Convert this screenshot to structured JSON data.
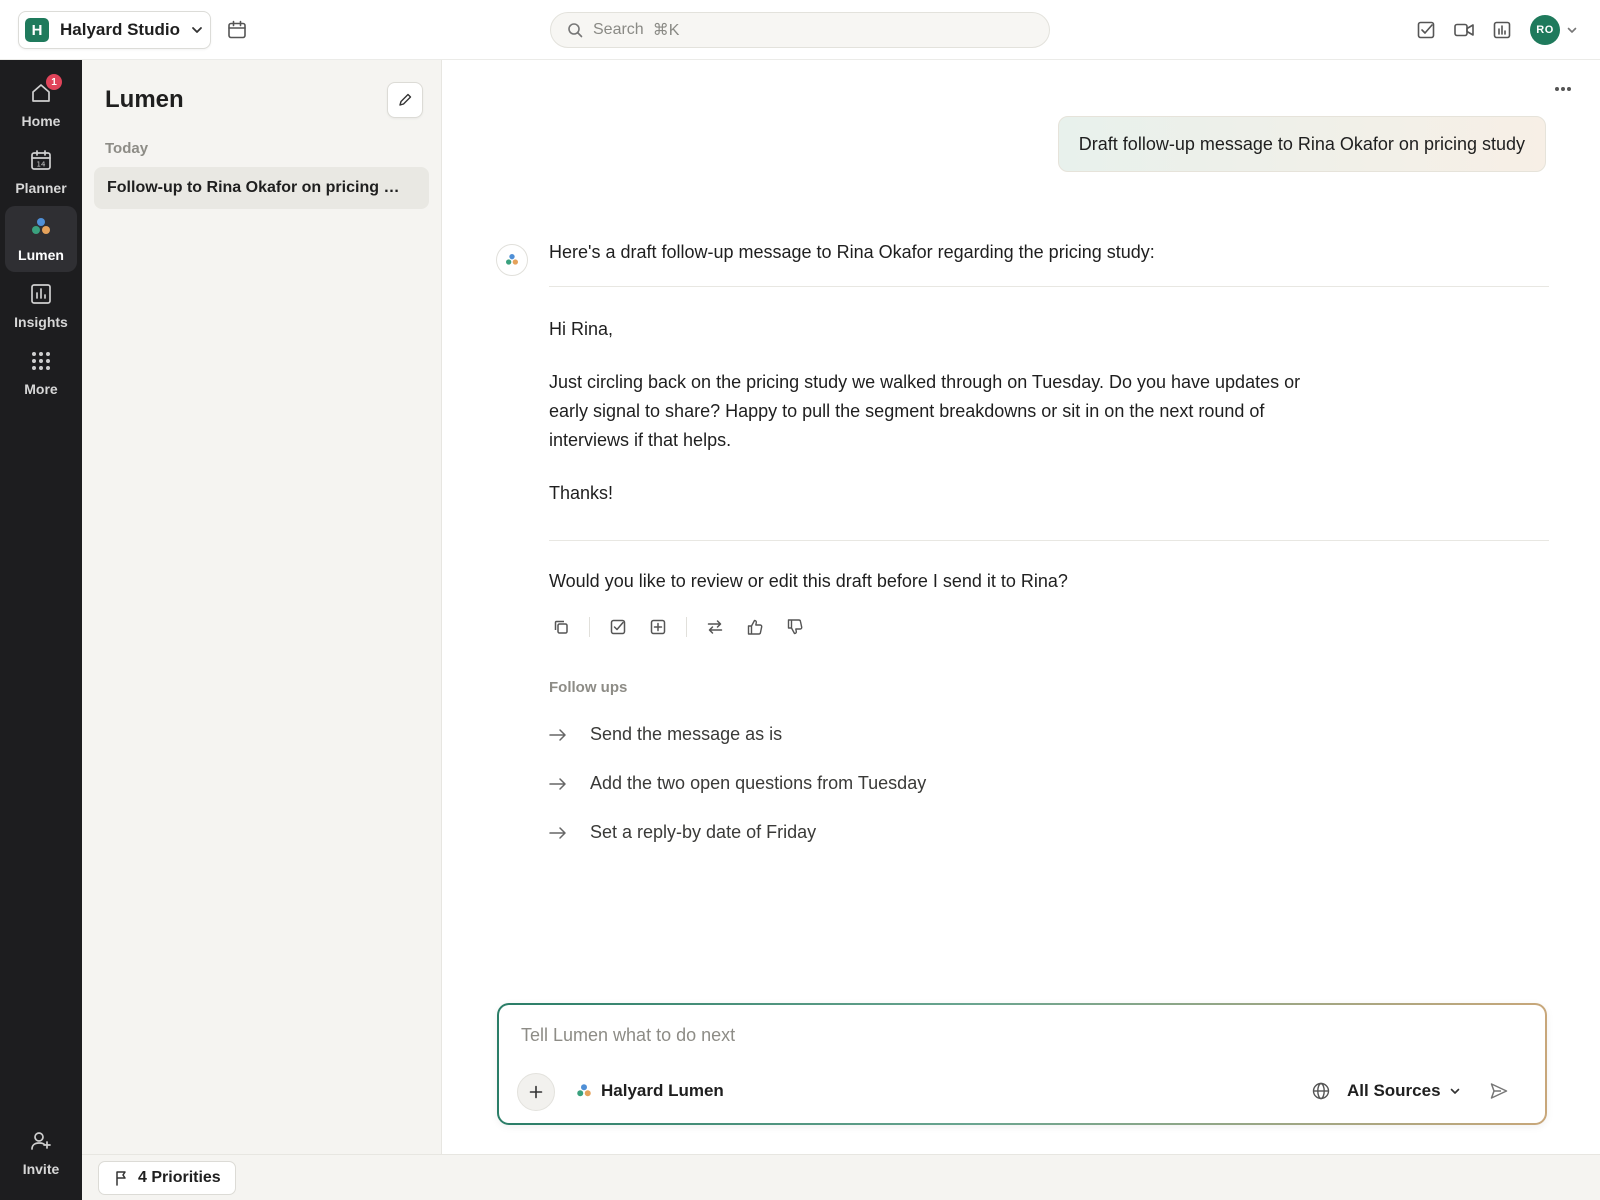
{
  "topbar": {
    "workspace_initial": "H",
    "workspace_name": "Halyard Studio",
    "search_placeholder": "Search",
    "search_shortcut": "⌘K",
    "avatar_initials": "RO",
    "icons": [
      "calendar-icon",
      "task-check-icon",
      "video-icon",
      "chart-panel-icon",
      "chevron-down-icon"
    ]
  },
  "rail": {
    "items": [
      {
        "label": "Home",
        "icon": "home-icon",
        "badge": "1"
      },
      {
        "label": "Planner",
        "icon": "planner-calendar-icon",
        "calendar_day": "14"
      },
      {
        "label": "Lumen",
        "icon": "lumen-icon",
        "active": true
      },
      {
        "label": "Insights",
        "icon": "insights-chart-icon"
      },
      {
        "label": "More",
        "icon": "grid-dots-icon"
      }
    ],
    "invite_label": "Invite"
  },
  "panel": {
    "title": "Lumen",
    "group_label": "Today",
    "conversations": [
      {
        "title": "Follow-up to Rina Okafor on pricing study"
      }
    ]
  },
  "bottombar": {
    "priorities_label": "4 Priorities"
  },
  "chat": {
    "user_message": "Draft follow-up message to Rina Okafor on pricing study",
    "intro": "Here's a draft follow-up message to Rina Okafor regarding the pricing study:",
    "draft": {
      "greeting": "Hi Rina,",
      "body": "Just circling back on the pricing study we walked through on Tuesday. Do you have updates or early signal to share? Happy to pull the segment breakdowns or sit in on the next round of interviews if that helps.",
      "signoff": "Thanks!"
    },
    "question": "Would you like to review or edit this draft before I send it to Rina?",
    "followups_label": "Follow ups",
    "followups": [
      "Send the message as is",
      "Add the two open questions from Tuesday",
      "Set a reply-by date of Friday"
    ]
  },
  "composer": {
    "placeholder": "Tell Lumen what to do next",
    "model_label": "Halyard Lumen",
    "sources_label": "All Sources"
  },
  "colors": {
    "brand_green": "#1f7a5c",
    "rail_bg": "#1d1d1f",
    "badge_red": "#e0445a",
    "panel_bg": "#f5f4f1"
  }
}
